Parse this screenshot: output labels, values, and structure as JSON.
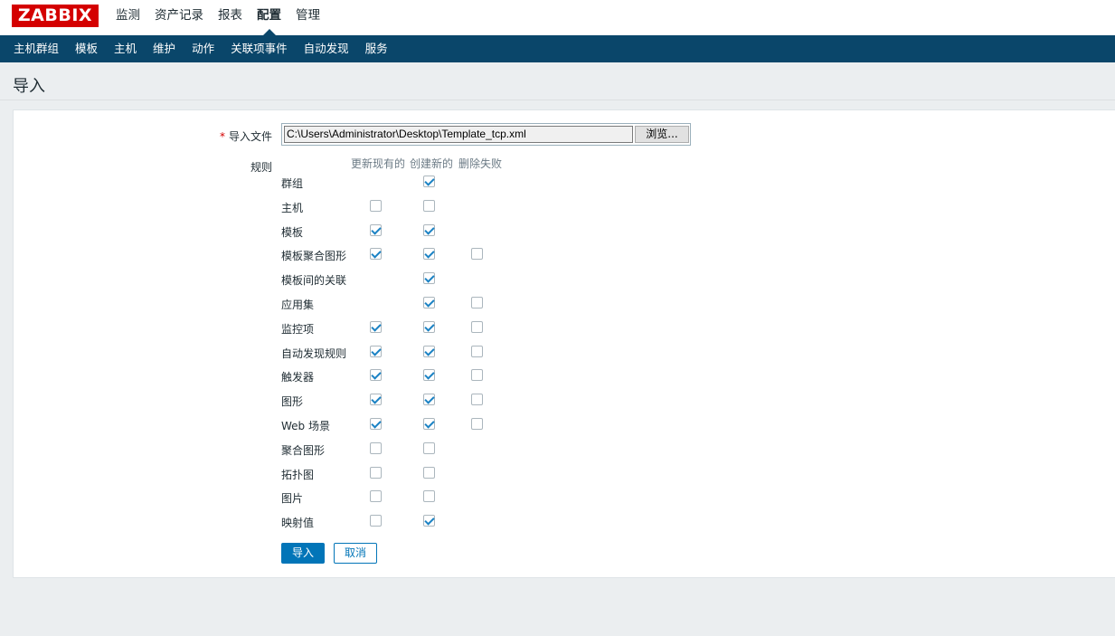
{
  "brand": {
    "logo_text": "ZABBIX",
    "logo_color": "#d40000",
    "nav_color": "#0a466a",
    "accent_color": "#0275b8"
  },
  "main_nav": [
    {
      "label": "监测",
      "active": false
    },
    {
      "label": "资产记录",
      "active": false
    },
    {
      "label": "报表",
      "active": false
    },
    {
      "label": "配置",
      "active": true
    },
    {
      "label": "管理",
      "active": false
    }
  ],
  "sub_nav": [
    {
      "label": "主机群组"
    },
    {
      "label": "模板"
    },
    {
      "label": "主机"
    },
    {
      "label": "维护"
    },
    {
      "label": "动作"
    },
    {
      "label": "关联项事件"
    },
    {
      "label": "自动发现"
    },
    {
      "label": "服务"
    }
  ],
  "page": {
    "title": "导入"
  },
  "form": {
    "import_file_required": "*",
    "import_file_label": "导入文件",
    "import_file_value": "C:\\Users\\Administrator\\Desktop\\Template_tcp.xml",
    "browse_label": "浏览...",
    "rules_label": "规则",
    "columns": {
      "update_existing": "更新现有的",
      "create_new": "创建新的",
      "delete_missing": "删除失败"
    },
    "rules": [
      {
        "label": "群组",
        "update": null,
        "create": true,
        "delete": null
      },
      {
        "label": "主机",
        "update": false,
        "create": false,
        "delete": null
      },
      {
        "label": "模板",
        "update": true,
        "create": true,
        "delete": null
      },
      {
        "label": "模板聚合图形",
        "update": true,
        "create": true,
        "delete": false
      },
      {
        "label": "模板间的关联",
        "update": null,
        "create": true,
        "delete": null
      },
      {
        "label": "应用集",
        "update": null,
        "create": true,
        "delete": false
      },
      {
        "label": "监控项",
        "update": true,
        "create": true,
        "delete": false
      },
      {
        "label": "自动发现规则",
        "update": true,
        "create": true,
        "delete": false
      },
      {
        "label": "触发器",
        "update": true,
        "create": true,
        "delete": false
      },
      {
        "label": "图形",
        "update": true,
        "create": true,
        "delete": false
      },
      {
        "label": "Web 场景",
        "update": true,
        "create": true,
        "delete": false
      },
      {
        "label": "聚合图形",
        "update": false,
        "create": false,
        "delete": null
      },
      {
        "label": "拓扑图",
        "update": false,
        "create": false,
        "delete": null
      },
      {
        "label": "图片",
        "update": false,
        "create": false,
        "delete": null
      },
      {
        "label": "映射值",
        "update": false,
        "create": true,
        "delete": null
      }
    ],
    "import_button": "导入",
    "cancel_button": "取消"
  }
}
